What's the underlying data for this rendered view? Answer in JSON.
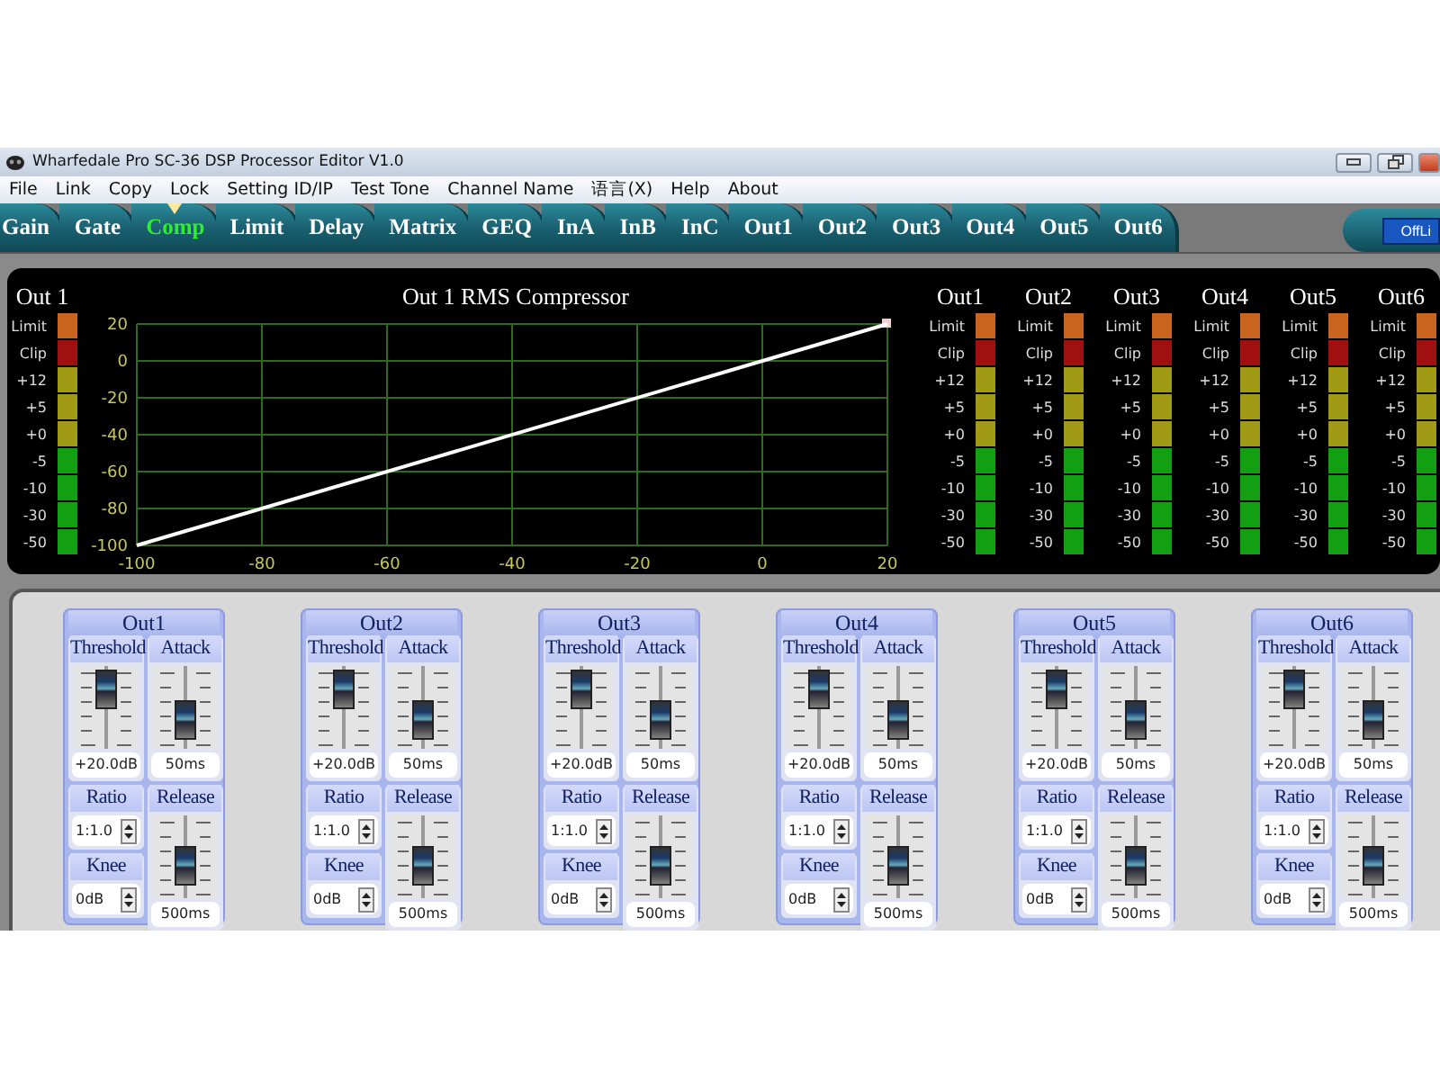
{
  "window": {
    "title": "Wharfedale Pro SC-36 DSP Processor Editor V1.0"
  },
  "menu": [
    "File",
    "Link",
    "Copy",
    "Lock",
    "Setting ID/IP",
    "Test Tone",
    "Channel Name",
    "语言(X)",
    "Help",
    "About"
  ],
  "tabs": [
    {
      "label": "Gain",
      "selected": false
    },
    {
      "label": "Gate",
      "selected": false
    },
    {
      "label": "Comp",
      "selected": true
    },
    {
      "label": "Limit",
      "selected": false
    },
    {
      "label": "Delay",
      "selected": false
    },
    {
      "label": "Matrix",
      "selected": false
    },
    {
      "label": "GEQ",
      "selected": false
    },
    {
      "label": "InA",
      "selected": false
    },
    {
      "label": "InB",
      "selected": false
    },
    {
      "label": "InC",
      "selected": false
    },
    {
      "label": "Out1",
      "selected": false
    },
    {
      "label": "Out2",
      "selected": false
    },
    {
      "label": "Out3",
      "selected": false
    },
    {
      "label": "Out4",
      "selected": false
    },
    {
      "label": "Out5",
      "selected": false
    },
    {
      "label": "Out6",
      "selected": false
    }
  ],
  "status_button": "OffLi",
  "channel_meter": {
    "title": "Out 1",
    "segments": [
      {
        "label": "Limit",
        "color": "#c8641e"
      },
      {
        "label": "Clip",
        "color": "#a01010"
      },
      {
        "label": "+12",
        "color": "#a09a14"
      },
      {
        "label": "+5",
        "color": "#a09a14"
      },
      {
        "label": "+0",
        "color": "#a09a14"
      },
      {
        "label": "-5",
        "color": "#12a012"
      },
      {
        "label": "-10",
        "color": "#12a012"
      },
      {
        "label": "-30",
        "color": "#12a012"
      },
      {
        "label": "-50",
        "color": "#12a012"
      }
    ]
  },
  "chart": {
    "title": "Out 1  RMS Compressor",
    "chart_data": {
      "type": "line",
      "x": [
        -100,
        20
      ],
      "series": [
        {
          "color": "#ffffff",
          "values": [
            -100,
            20
          ]
        }
      ],
      "grid": true,
      "xlim": [
        -100,
        20
      ],
      "ylim": [
        -100,
        20
      ],
      "xticks": [
        -100,
        -80,
        -60,
        -40,
        -20,
        0,
        20
      ],
      "yticks": [
        -100,
        -80,
        -60,
        -40,
        -20,
        0,
        20
      ]
    }
  },
  "meters": [
    {
      "title": "Out1",
      "segments": [
        {
          "label": "Limit",
          "color": "#c8641e"
        },
        {
          "label": "Clip",
          "color": "#a01010"
        },
        {
          "label": "+12",
          "color": "#a09a14"
        },
        {
          "label": "+5",
          "color": "#a09a14"
        },
        {
          "label": "+0",
          "color": "#a09a14"
        },
        {
          "label": "-5",
          "color": "#12a012"
        },
        {
          "label": "-10",
          "color": "#12a012"
        },
        {
          "label": "-30",
          "color": "#12a012"
        },
        {
          "label": "-50",
          "color": "#12a012"
        }
      ]
    },
    {
      "title": "Out2",
      "segments": [
        {
          "label": "Limit",
          "color": "#c8641e"
        },
        {
          "label": "Clip",
          "color": "#a01010"
        },
        {
          "label": "+12",
          "color": "#a09a14"
        },
        {
          "label": "+5",
          "color": "#a09a14"
        },
        {
          "label": "+0",
          "color": "#a09a14"
        },
        {
          "label": "-5",
          "color": "#12a012"
        },
        {
          "label": "-10",
          "color": "#12a012"
        },
        {
          "label": "-30",
          "color": "#12a012"
        },
        {
          "label": "-50",
          "color": "#12a012"
        }
      ]
    },
    {
      "title": "Out3",
      "segments": [
        {
          "label": "Limit",
          "color": "#c8641e"
        },
        {
          "label": "Clip",
          "color": "#a01010"
        },
        {
          "label": "+12",
          "color": "#a09a14"
        },
        {
          "label": "+5",
          "color": "#a09a14"
        },
        {
          "label": "+0",
          "color": "#a09a14"
        },
        {
          "label": "-5",
          "color": "#12a012"
        },
        {
          "label": "-10",
          "color": "#12a012"
        },
        {
          "label": "-30",
          "color": "#12a012"
        },
        {
          "label": "-50",
          "color": "#12a012"
        }
      ]
    },
    {
      "title": "Out4",
      "segments": [
        {
          "label": "Limit",
          "color": "#c8641e"
        },
        {
          "label": "Clip",
          "color": "#a01010"
        },
        {
          "label": "+12",
          "color": "#a09a14"
        },
        {
          "label": "+5",
          "color": "#a09a14"
        },
        {
          "label": "+0",
          "color": "#a09a14"
        },
        {
          "label": "-5",
          "color": "#12a012"
        },
        {
          "label": "-10",
          "color": "#12a012"
        },
        {
          "label": "-30",
          "color": "#12a012"
        },
        {
          "label": "-50",
          "color": "#12a012"
        }
      ]
    },
    {
      "title": "Out5",
      "segments": [
        {
          "label": "Limit",
          "color": "#c8641e"
        },
        {
          "label": "Clip",
          "color": "#a01010"
        },
        {
          "label": "+12",
          "color": "#a09a14"
        },
        {
          "label": "+5",
          "color": "#a09a14"
        },
        {
          "label": "+0",
          "color": "#a09a14"
        },
        {
          "label": "-5",
          "color": "#12a012"
        },
        {
          "label": "-10",
          "color": "#12a012"
        },
        {
          "label": "-30",
          "color": "#12a012"
        },
        {
          "label": "-50",
          "color": "#12a012"
        }
      ]
    },
    {
      "title": "Out6",
      "segments": [
        {
          "label": "Limit",
          "color": "#c8641e"
        },
        {
          "label": "Clip",
          "color": "#a01010"
        },
        {
          "label": "+12",
          "color": "#a09a14"
        },
        {
          "label": "+5",
          "color": "#a09a14"
        },
        {
          "label": "+0",
          "color": "#a09a14"
        },
        {
          "label": "-5",
          "color": "#12a012"
        },
        {
          "label": "-10",
          "color": "#12a012"
        },
        {
          "label": "-30",
          "color": "#12a012"
        },
        {
          "label": "-50",
          "color": "#12a012"
        }
      ]
    }
  ],
  "strips": [
    {
      "title": "Out1",
      "threshold": {
        "label": "Threshold",
        "level": 0.9,
        "value": "+20.0dB"
      },
      "attack": {
        "label": "Attack",
        "level": 0.2,
        "value": "50ms"
      },
      "ratio": {
        "label": "Ratio",
        "value": "1:1.0"
      },
      "knee": {
        "label": "Knee",
        "value": "0dB"
      },
      "release": {
        "label": "Release",
        "level": 0.3,
        "value": "500ms"
      }
    },
    {
      "title": "Out2",
      "threshold": {
        "label": "Threshold",
        "level": 0.9,
        "value": "+20.0dB"
      },
      "attack": {
        "label": "Attack",
        "level": 0.2,
        "value": "50ms"
      },
      "ratio": {
        "label": "Ratio",
        "value": "1:1.0"
      },
      "knee": {
        "label": "Knee",
        "value": "0dB"
      },
      "release": {
        "label": "Release",
        "level": 0.3,
        "value": "500ms"
      }
    },
    {
      "title": "Out3",
      "threshold": {
        "label": "Threshold",
        "level": 0.9,
        "value": "+20.0dB"
      },
      "attack": {
        "label": "Attack",
        "level": 0.2,
        "value": "50ms"
      },
      "ratio": {
        "label": "Ratio",
        "value": "1:1.0"
      },
      "knee": {
        "label": "Knee",
        "value": "0dB"
      },
      "release": {
        "label": "Release",
        "level": 0.3,
        "value": "500ms"
      }
    },
    {
      "title": "Out4",
      "threshold": {
        "label": "Threshold",
        "level": 0.9,
        "value": "+20.0dB"
      },
      "attack": {
        "label": "Attack",
        "level": 0.2,
        "value": "50ms"
      },
      "ratio": {
        "label": "Ratio",
        "value": "1:1.0"
      },
      "knee": {
        "label": "Knee",
        "value": "0dB"
      },
      "release": {
        "label": "Release",
        "level": 0.3,
        "value": "500ms"
      }
    },
    {
      "title": "Out5",
      "threshold": {
        "label": "Threshold",
        "level": 0.9,
        "value": "+20.0dB"
      },
      "attack": {
        "label": "Attack",
        "level": 0.2,
        "value": "50ms"
      },
      "ratio": {
        "label": "Ratio",
        "value": "1:1.0"
      },
      "knee": {
        "label": "Knee",
        "value": "0dB"
      },
      "release": {
        "label": "Release",
        "level": 0.3,
        "value": "500ms"
      }
    },
    {
      "title": "Out6",
      "threshold": {
        "label": "Threshold",
        "level": 0.9,
        "value": "+20.0dB"
      },
      "attack": {
        "label": "Attack",
        "level": 0.2,
        "value": "50ms"
      },
      "ratio": {
        "label": "Ratio",
        "value": "1:1.0"
      },
      "knee": {
        "label": "Knee",
        "value": "0dB"
      },
      "release": {
        "label": "Release",
        "level": 0.3,
        "value": "500ms"
      }
    }
  ]
}
